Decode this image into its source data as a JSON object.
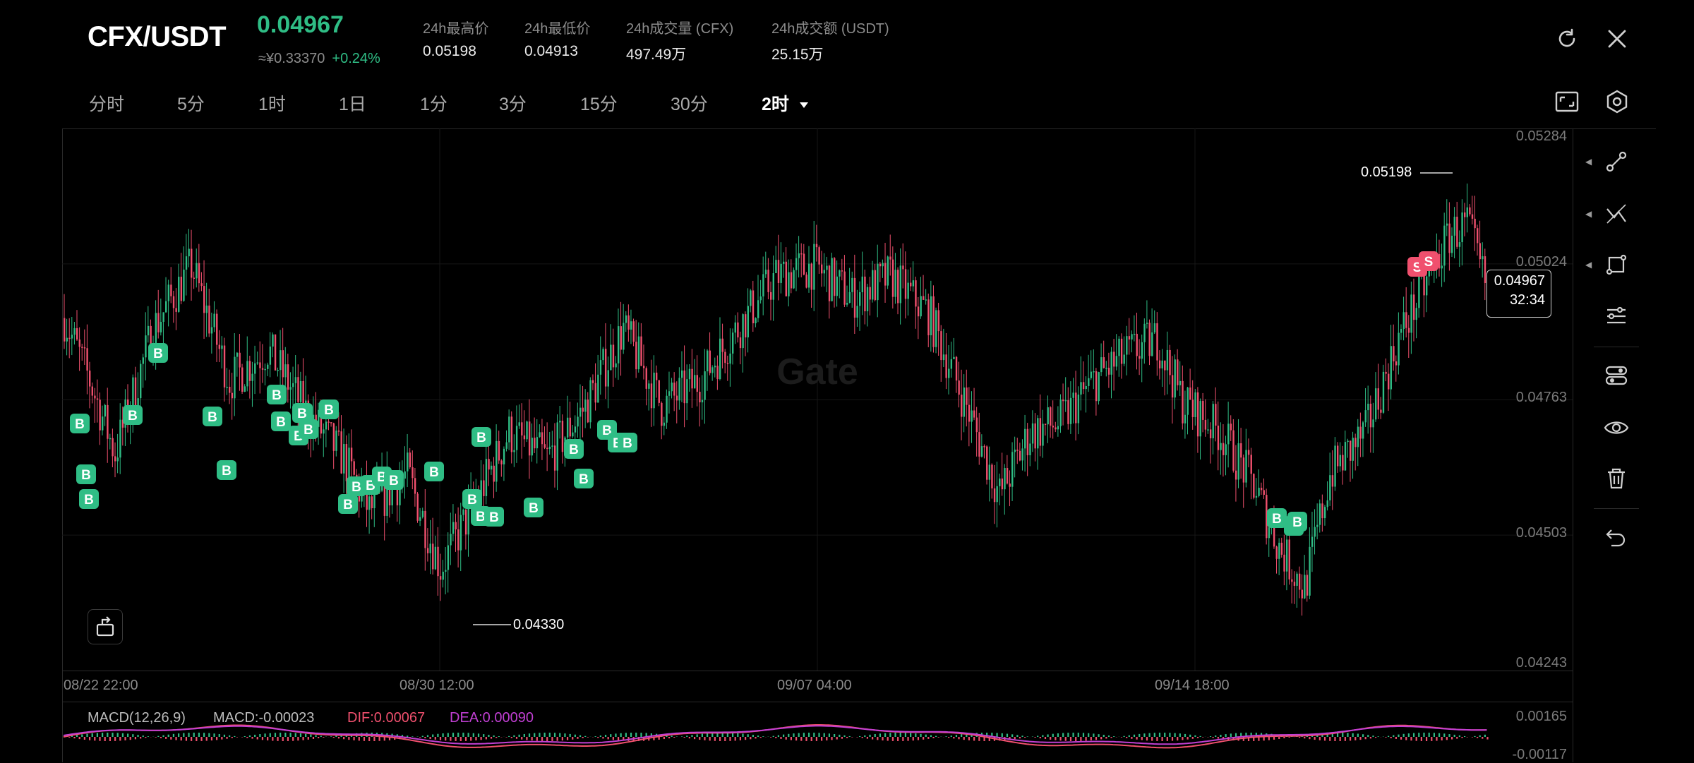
{
  "header": {
    "pair": "CFX/USDT",
    "last_price": "0.04967",
    "cny_price": "≈¥0.33370",
    "change": "+0.24%",
    "stats": [
      {
        "label": "24h最高价",
        "value": "0.05198"
      },
      {
        "label": "24h最低价",
        "value": "0.04913"
      },
      {
        "label": "24h成交量 (CFX)",
        "value": "497.49万"
      },
      {
        "label": "24h成交额 (USDT)",
        "value": "25.15万"
      }
    ]
  },
  "tabs": [
    "分时",
    "5分",
    "1时",
    "1日",
    "1分",
    "3分",
    "15分",
    "30分",
    "2时"
  ],
  "active_tab": "2时",
  "chart": {
    "watermark": "Gate",
    "y_ticks": [
      "0.05284",
      "0.05024",
      "0.04763",
      "0.04503",
      "0.04243"
    ],
    "x_ticks": [
      "08/22 22:00",
      "08/30 12:00",
      "09/07 04:00",
      "09/14 18:00"
    ],
    "high_label": "0.05198",
    "low_label": "0.04330",
    "current_price": "0.04967",
    "countdown": "32:34",
    "buy_marker": "B",
    "sell_marker": "S"
  },
  "macd": {
    "title": "MACD(12,26,9)",
    "macd": "MACD:-0.00023",
    "dif": "DIF:0.00067",
    "dea": "DEA:0.00090",
    "y_top": "0.00165",
    "y_bottom": "-0.00117"
  },
  "chart_data": {
    "type": "candlestick",
    "interval": "2时",
    "y_range": [
      0.04243,
      0.05284
    ],
    "series_summary": {
      "high": 0.05198,
      "low": 0.0433,
      "last": 0.04967
    },
    "x_ticks": [
      "08/22 22:00",
      "08/30 12:00",
      "09/07 04:00",
      "09/14 18:00"
    ]
  },
  "colors": {
    "up": "#2fbd85",
    "down": "#f0506e",
    "dif": "#f0506e",
    "dea": "#c13fd3",
    "bg": "#000000"
  }
}
